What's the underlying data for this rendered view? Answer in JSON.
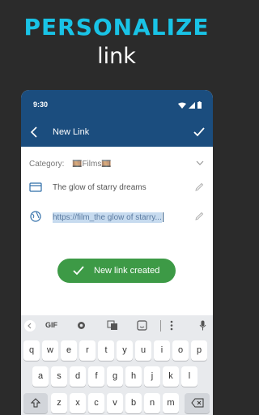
{
  "promo": {
    "title": "PERSONALIZE",
    "subtitle": "link"
  },
  "status_bar": {
    "time": "9:30"
  },
  "app_bar": {
    "title": "New Link"
  },
  "form": {
    "category_label": "Category:",
    "category_value": "🎞️Films🎞️",
    "title_value": "The glow of starry dreams",
    "url_value": "https://film_the glow of  starry..."
  },
  "toast": {
    "text": "New link created"
  },
  "keyboard": {
    "toolbar": {
      "gif": "GIF"
    },
    "row1": [
      "q",
      "w",
      "e",
      "r",
      "t",
      "y",
      "u",
      "i",
      "o",
      "p"
    ],
    "row2": [
      "a",
      "s",
      "d",
      "f",
      "g",
      "h",
      "j",
      "k",
      "l"
    ],
    "row3": [
      "z",
      "x",
      "c",
      "v",
      "b",
      "n",
      "m"
    ]
  },
  "colors": {
    "appbar": "#1b4d7e",
    "accent": "#19c3e6",
    "success": "#3d9a46"
  },
  "icons": [
    "back-arrow-icon",
    "check-icon",
    "chevron-down-icon",
    "title-card-icon",
    "globe-icon",
    "pencil-icon",
    "gear-icon",
    "translate-icon",
    "sticker-icon",
    "mic-icon",
    "shift-icon",
    "backspace-icon",
    "wifi-icon",
    "signal-icon",
    "battery-icon"
  ]
}
